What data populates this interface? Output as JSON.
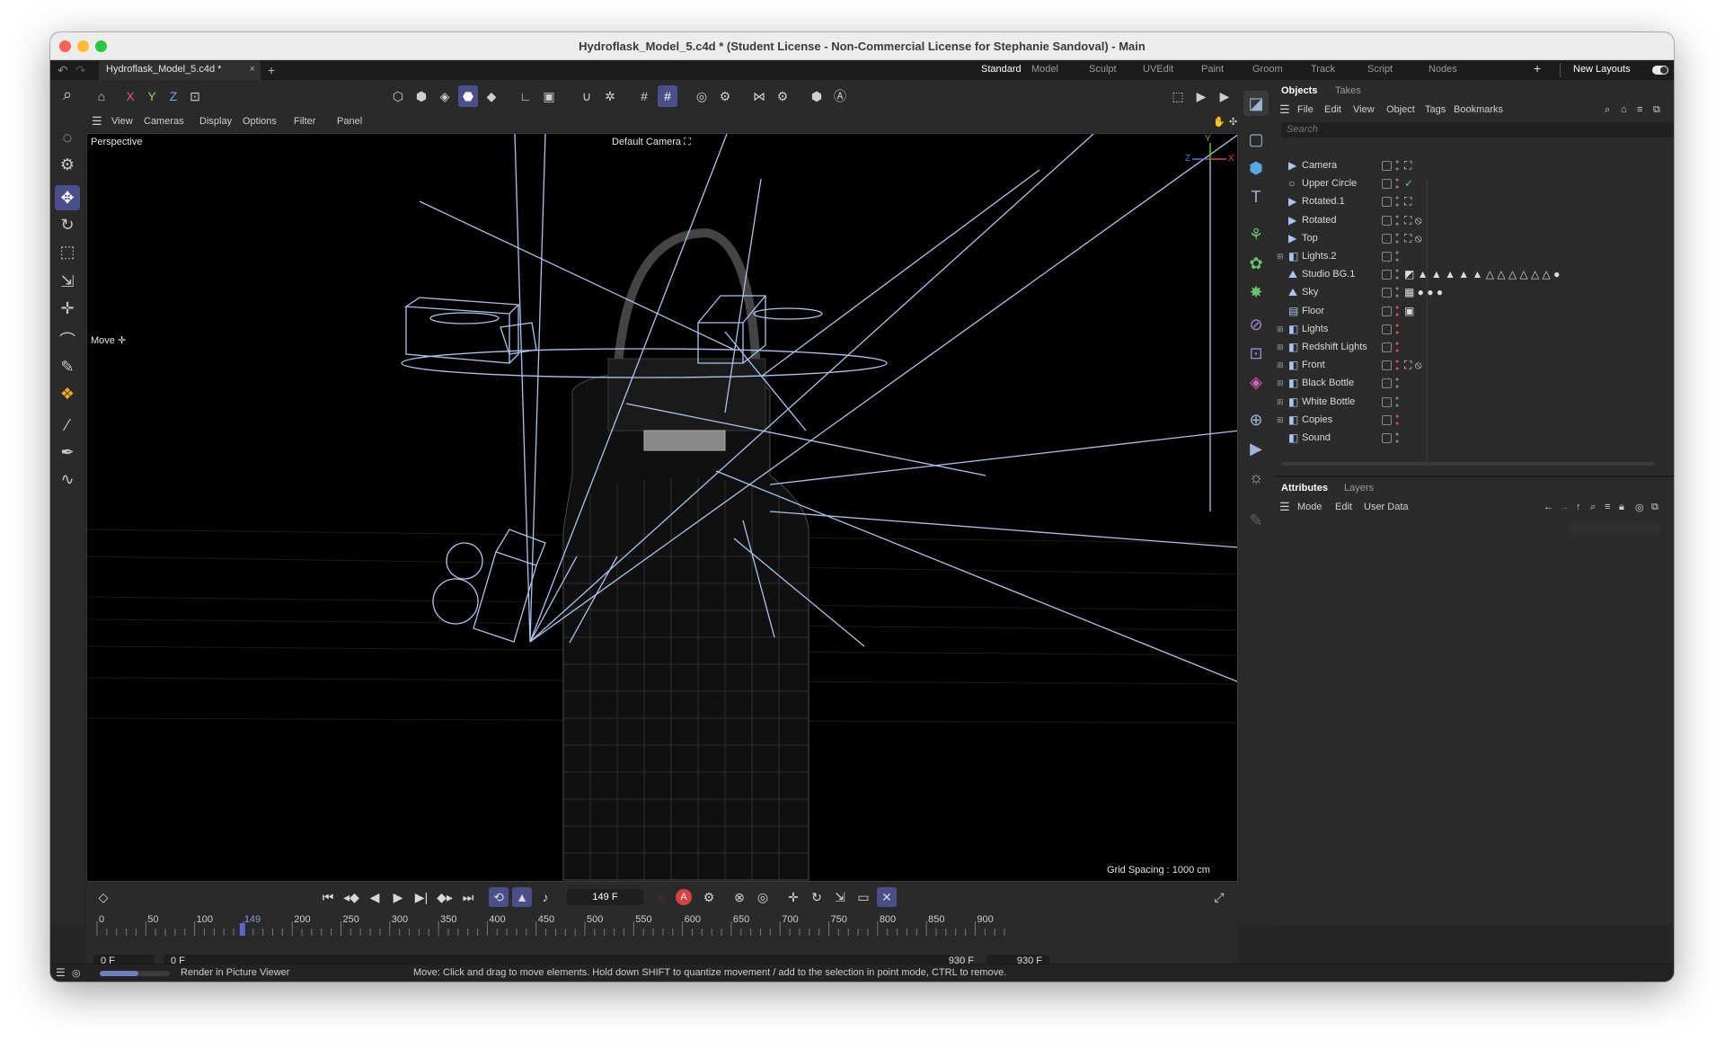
{
  "window": {
    "title": "Hydroflask_Model_5.c4d * (Student License - Non-Commercial License for Stephanie Sandoval) - Main",
    "traffic_lights": {
      "close": "#ff5f57",
      "minimize": "#febc2e",
      "zoom": "#28c840"
    }
  },
  "tabs": {
    "document": "Hydroflask_Model_5.c4d *",
    "close_glyph": "×",
    "new_glyph": "+",
    "layouts": [
      "Standard",
      "Model",
      "Sculpt",
      "UVEdit",
      "Paint",
      "Groom",
      "Track",
      "Script",
      "Nodes"
    ],
    "active_layout": "Standard",
    "add_layout_glyph": "+",
    "new_layouts": "New Layouts"
  },
  "toolbar": {
    "axis_x": "X",
    "axis_y": "Y",
    "axis_z": "Z"
  },
  "viewport_menu": [
    "View",
    "Cameras",
    "Display",
    "Options",
    "Filter",
    "Panel"
  ],
  "viewport": {
    "projection": "Perspective",
    "camera": "Default Camera",
    "camera_icon": "camera-icon",
    "tool_hint": "Move",
    "grid_spacing": "Grid Spacing : 1000 cm",
    "axis_x": "X",
    "axis_y": "Y",
    "axis_z": "Z"
  },
  "objects_panel": {
    "tabs": [
      "Objects",
      "Takes"
    ],
    "active_tab": "Objects",
    "menu": [
      "File",
      "Edit",
      "View",
      "Object",
      "Tags",
      "Bookmarks"
    ],
    "search_placeholder": "Search",
    "objects": [
      {
        "name": "Camera",
        "icon": "camera-icon",
        "expandable": false,
        "tag": "⛶"
      },
      {
        "name": "Upper Circle",
        "icon": "circle-icon",
        "expandable": false,
        "tag": "✓"
      },
      {
        "name": "Rotated.1",
        "icon": "camera-icon",
        "expandable": false,
        "tag": "⛶"
      },
      {
        "name": "Rotated",
        "icon": "camera-icon",
        "expandable": false,
        "tag": "⛶ ⦸"
      },
      {
        "name": "Top",
        "icon": "camera-icon",
        "expandable": false,
        "tag": "⛶ ⦸"
      },
      {
        "name": "Lights.2",
        "icon": "null-icon",
        "expandable": true,
        "tag": ""
      },
      {
        "name": "Studio BG.1",
        "icon": "sky-icon",
        "expandable": false,
        "tag": "◩ ▲ ▲ ▲ ▲ ▲ △ △ △ △ △ △ ●"
      },
      {
        "name": "Sky",
        "icon": "sky-icon",
        "expandable": false,
        "tag": "▦ ● ● ●"
      },
      {
        "name": "Floor",
        "icon": "floor-icon",
        "expandable": false,
        "tag": "▣"
      },
      {
        "name": "Lights",
        "icon": "null-icon",
        "expandable": true,
        "tag": ""
      },
      {
        "name": "Redshift Lights",
        "icon": "null-icon",
        "expandable": true,
        "tag": ""
      },
      {
        "name": "Front",
        "icon": "null-icon",
        "expandable": true,
        "tag": "⛶ ⦸"
      },
      {
        "name": "Black Bottle",
        "icon": "null-icon",
        "expandable": true,
        "tag": ""
      },
      {
        "name": "White Bottle",
        "icon": "null-icon",
        "expandable": true,
        "tag": ""
      },
      {
        "name": "Copies",
        "icon": "null-icon",
        "expandable": true,
        "tag": ""
      },
      {
        "name": "Sound",
        "icon": "null-icon",
        "expandable": false,
        "tag": ""
      }
    ]
  },
  "attributes_panel": {
    "tabs": [
      "Attributes",
      "Layers"
    ],
    "active_tab": "Attributes",
    "menu": [
      "Mode",
      "Edit",
      "User Data"
    ]
  },
  "timeline": {
    "current_frame": "149 F",
    "ruler": [
      "0",
      "50",
      "100",
      "149",
      "200",
      "250",
      "300",
      "350",
      "400",
      "450",
      "500",
      "550",
      "600",
      "650",
      "700",
      "750",
      "800",
      "850",
      "900"
    ],
    "start_min": "0 F",
    "start": "0 F",
    "end": "930 F",
    "end_max": "930 F",
    "playhead_frame": 149,
    "frame_max": 930
  },
  "status_bar": {
    "progress": 0.55,
    "render_label": "Render in Picture Viewer",
    "message": "Move: Click and drag to move elements. Hold down SHIFT to quantize movement / add to the selection in point mode, CTRL to remove."
  },
  "colors": {
    "accent": "#4a4f8a",
    "wireframe": "#a8c6f0",
    "record_red": "#e64a4a",
    "active_check": "#4cd964"
  }
}
